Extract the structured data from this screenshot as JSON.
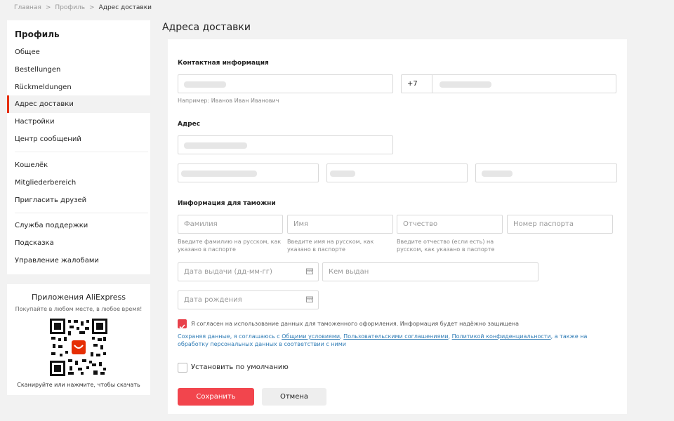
{
  "breadcrumb": {
    "items": [
      "Главная",
      "Профиль"
    ],
    "separator": ">",
    "current": "Адрес доставки"
  },
  "sidebar": {
    "title": "Профиль",
    "items": [
      {
        "label": "Общее"
      },
      {
        "label": "Bestellungen"
      },
      {
        "label": "Rückmeldungen"
      },
      {
        "label": "Адрес доставки",
        "active": true
      },
      {
        "label": "Настройки"
      },
      {
        "label": "Центр сообщений"
      },
      {
        "label": "Кошелёк"
      },
      {
        "label": "Mitgliederbereich"
      },
      {
        "label": "Пригласить друзей"
      },
      {
        "label": "Служба поддержки"
      },
      {
        "label": "Подсказка"
      },
      {
        "label": "Управление жалобами"
      }
    ],
    "active_color": "#e62e04"
  },
  "apps": {
    "title": "Приложения AliExpress",
    "subtitle": "Покупайте в любом месте, в любое время!",
    "footer": "Сканируйте или нажмите, чтобы скачать"
  },
  "page_title": "Адреса доставки",
  "contact": {
    "heading": "Контактная информация",
    "name_hint": "Например: Иванов Иван Иванович",
    "phone_prefix": "+7"
  },
  "address": {
    "heading": "Адрес"
  },
  "customs": {
    "heading": "Информация для таможни",
    "surname_placeholder": "Фамилия",
    "name_placeholder": "Имя",
    "patronymic_placeholder": "Отчество",
    "passport_placeholder": "Номер паспорта",
    "surname_hint": "Введите фамилию на русском, как указано в паспорте",
    "name_hint": "Введите имя на русском, как указано в паспорте",
    "patronymic_hint": "Введите отчество (если есть) на русском, как указано в паспорте",
    "issue_date_placeholder": "Дата выдачи (дд-мм-гг)",
    "issued_by_placeholder": "Кем выдан",
    "birth_date_placeholder": "Дата рождения"
  },
  "consent": {
    "checkbox_label": "Я согласен на использование данных для таможенного оформления. Информация будет надёжно защищена",
    "checked": true,
    "text_prefix": "Сохраняя данные, я соглашаюсь с ",
    "link_terms": "Общими условиями",
    "sep1": ", ",
    "link_user_agreements": "Пользовательскими соглашениями",
    "sep2": ", ",
    "link_privacy": "Политикой конфиденциальности",
    "text_suffix": ", а также на обработку персональных данных в соответствии с ними"
  },
  "default_label": "Установить по умолчанию",
  "default_checked": false,
  "buttons": {
    "save": "Сохранить",
    "cancel": "Отмена"
  },
  "colors": {
    "accent": "#f2454d",
    "link": "#2e7bb5"
  }
}
